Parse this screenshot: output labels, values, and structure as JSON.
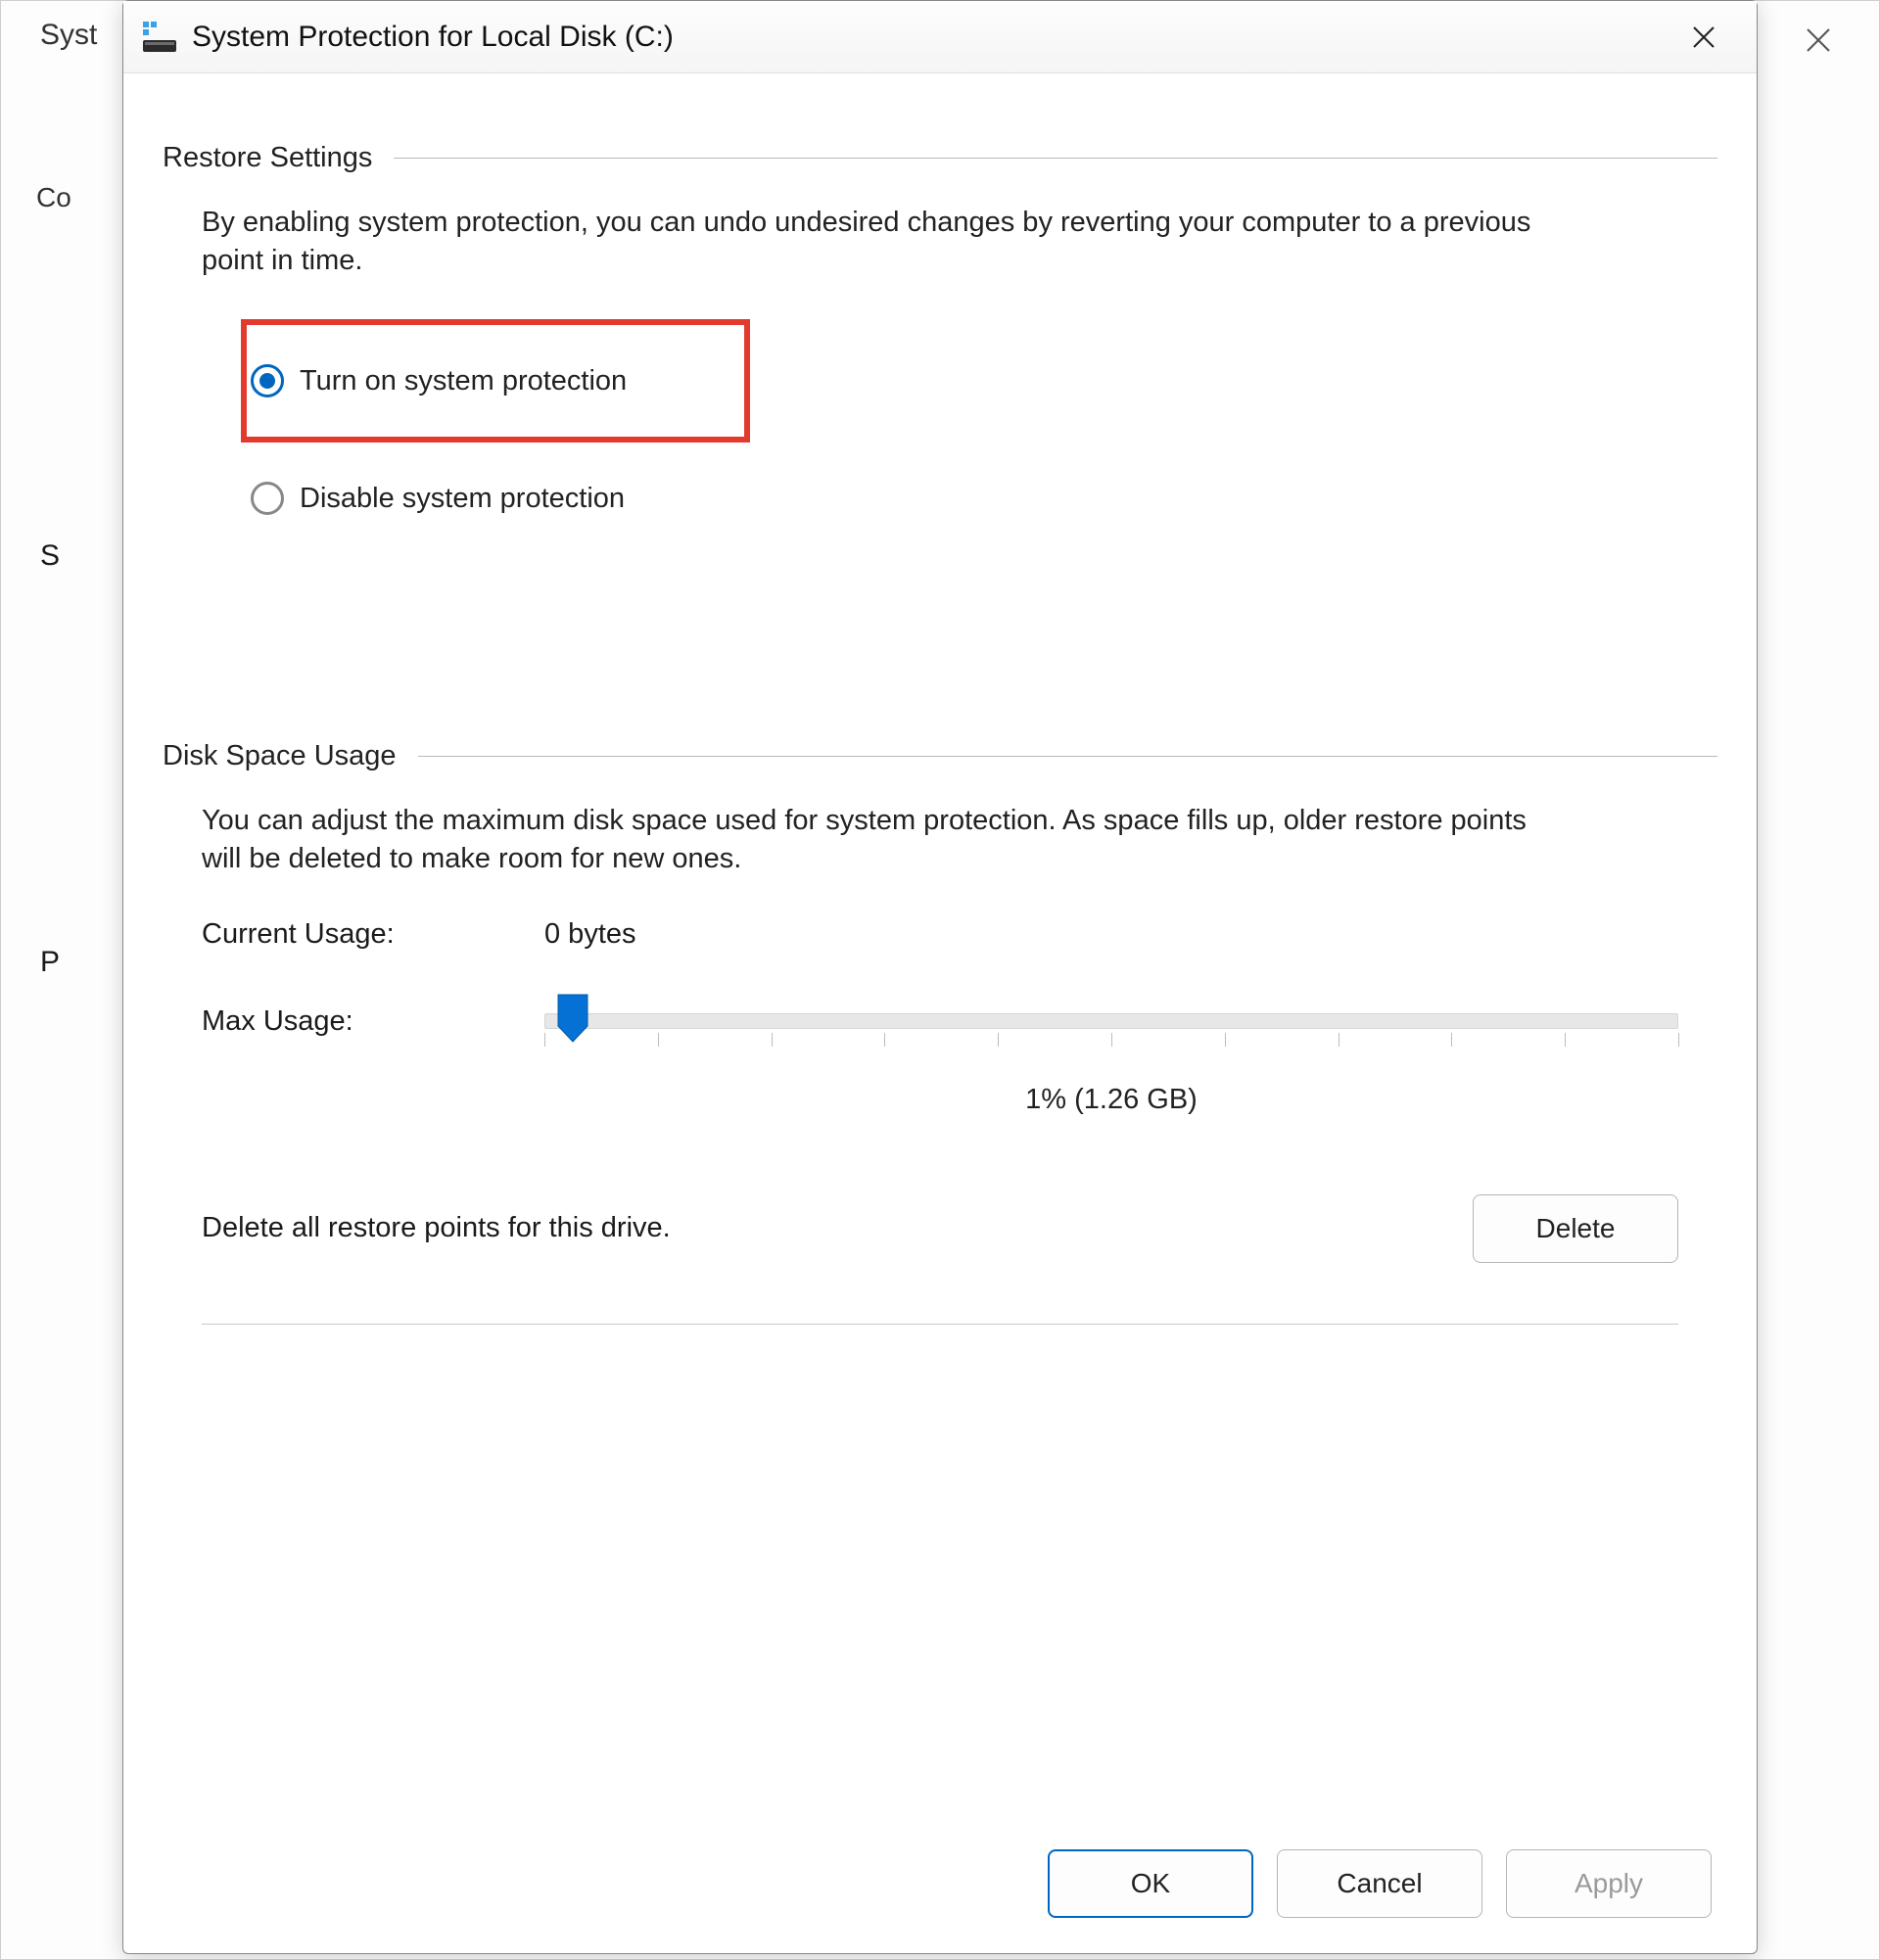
{
  "background": {
    "title_fragment": "Syst",
    "tab_fragment": "Co",
    "letter_s": "S",
    "letter_p": "P"
  },
  "dialog": {
    "title": "System Protection for Local Disk (C:)",
    "sections": {
      "restore": {
        "header": "Restore Settings",
        "description": "By enabling system protection, you can undo undesired changes by reverting your computer to a previous point in time.",
        "options": {
          "turn_on": "Turn on system protection",
          "disable": "Disable system protection"
        },
        "selected": "turn_on"
      },
      "disk": {
        "header": "Disk Space Usage",
        "description": "You can adjust the maximum disk space used for system protection. As space fills up, older restore points will be deleted to make room for new ones.",
        "current_usage_label": "Current Usage:",
        "current_usage_value": "0 bytes",
        "max_usage_label": "Max Usage:",
        "slider_value_text": "1% (1.26 GB)",
        "delete_text": "Delete all restore points for this drive.",
        "delete_button": "Delete"
      }
    },
    "footer": {
      "ok": "OK",
      "cancel": "Cancel",
      "apply": "Apply"
    }
  }
}
